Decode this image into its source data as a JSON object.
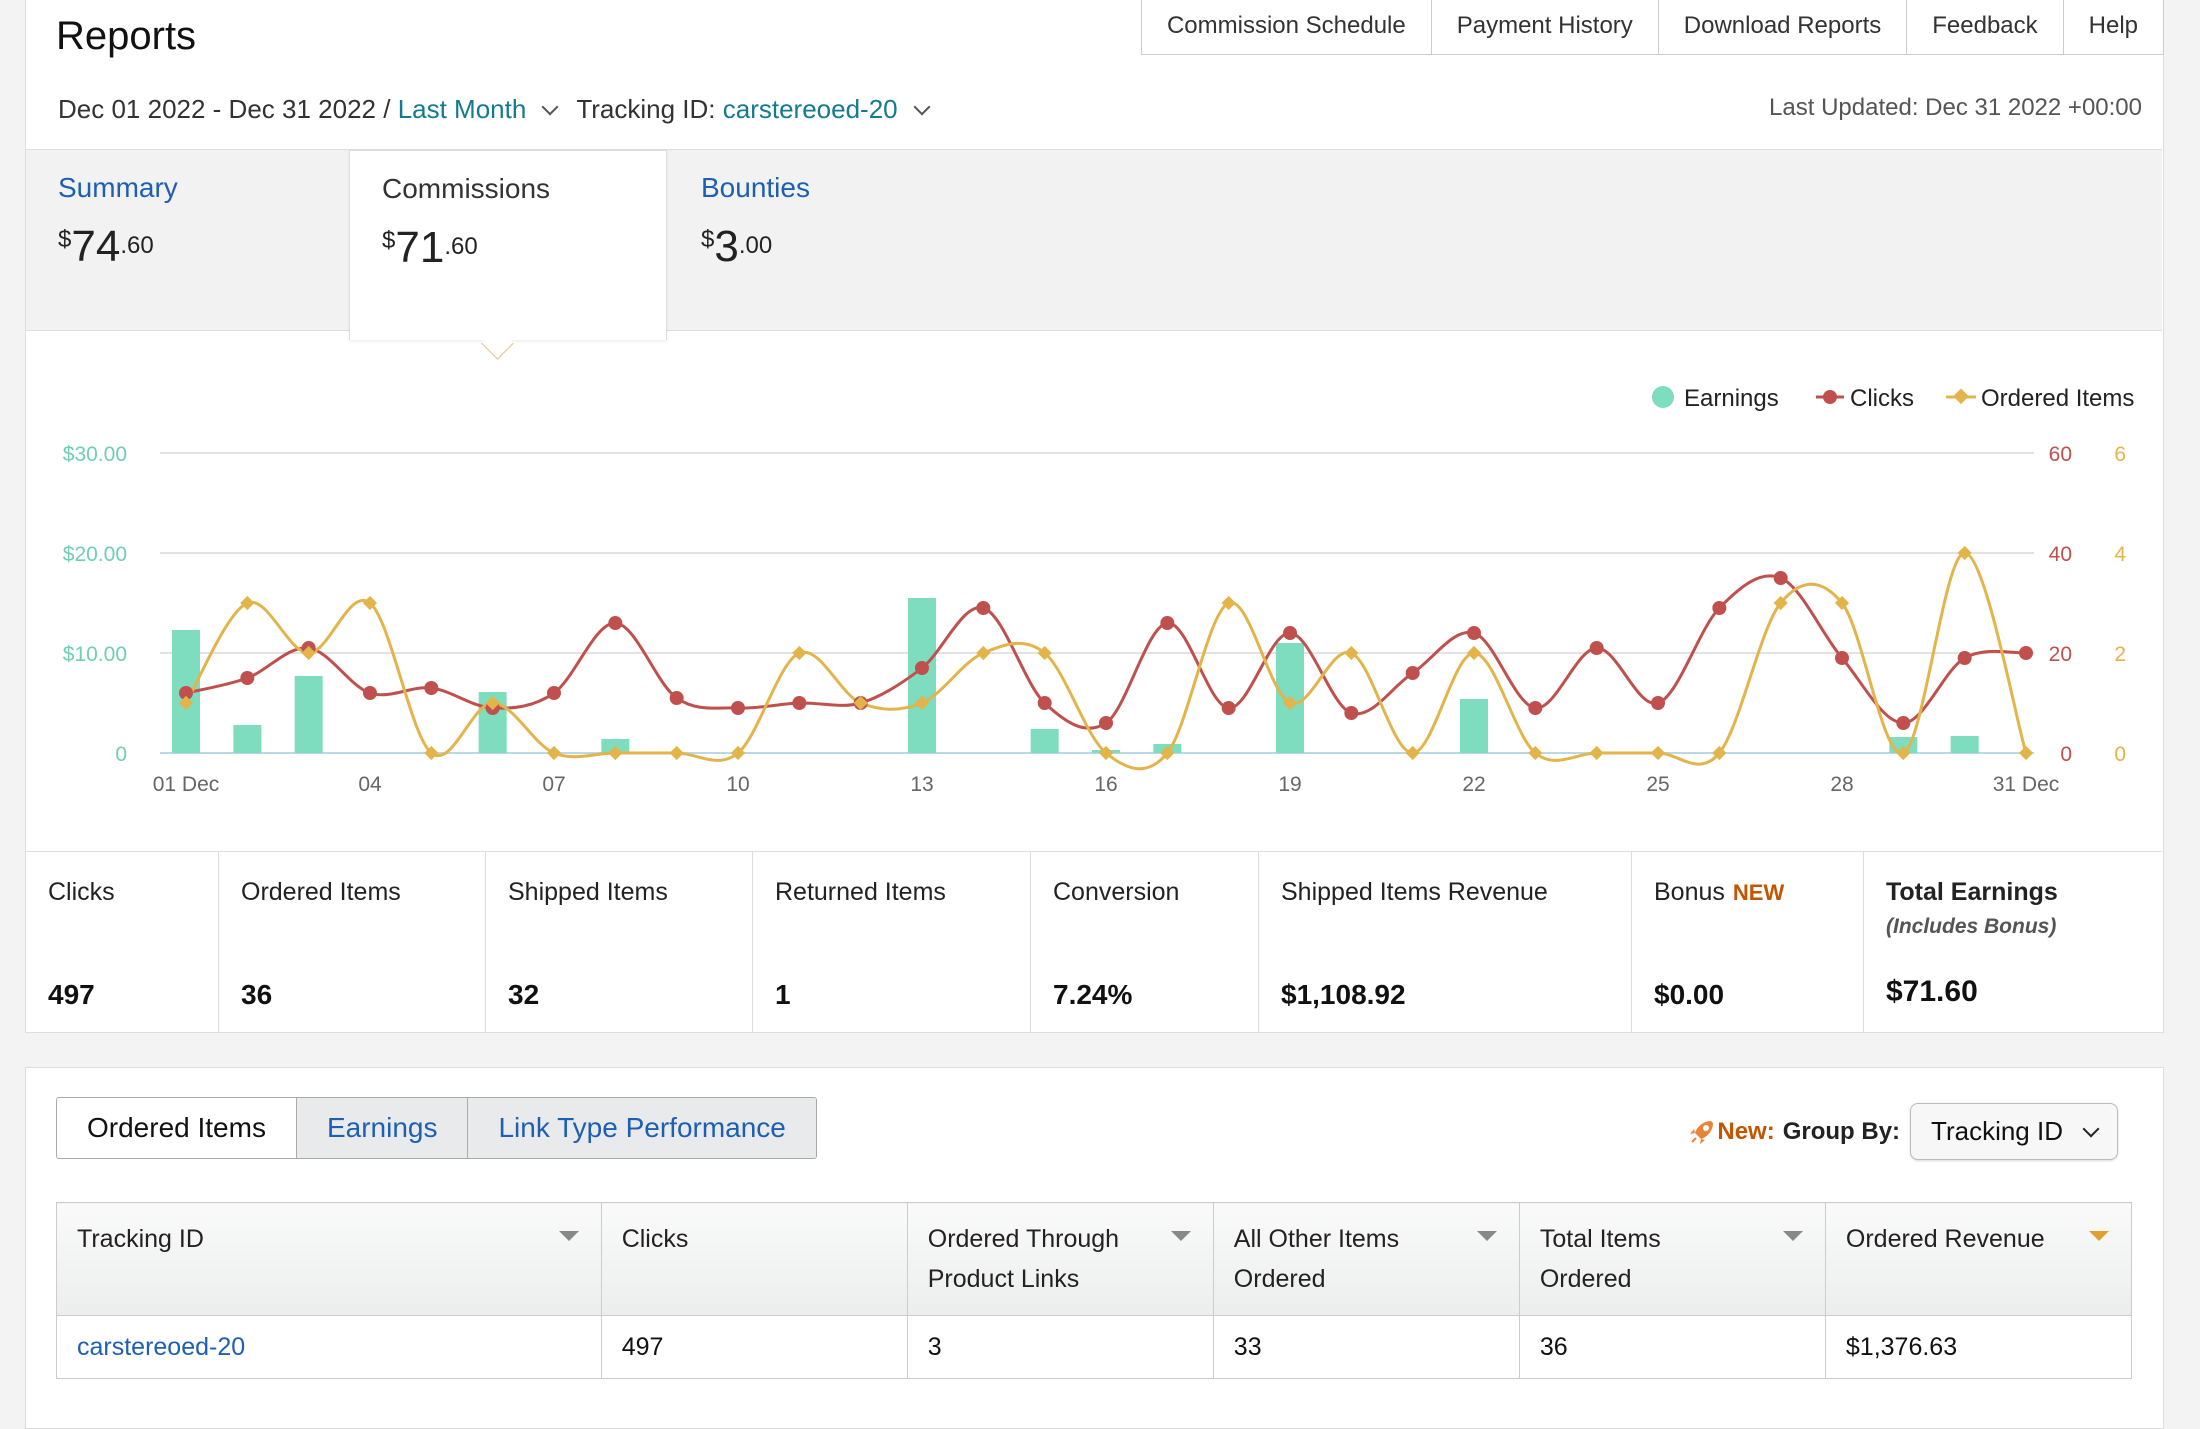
{
  "page": {
    "title": "Reports"
  },
  "nav_tabs": [
    "Commission Schedule",
    "Payment History",
    "Download Reports",
    "Feedback",
    "Help"
  ],
  "filters": {
    "date_range": "Dec 01 2022 - Dec 31 2022 /",
    "preset": "Last Month",
    "tracking_label": "Tracking ID:",
    "tracking_value": "carstereoed-20"
  },
  "last_updated": "Last Updated: Dec 31 2022 +00:00",
  "summary_tabs": [
    {
      "label": "Summary",
      "currency": "$",
      "dollars": "74",
      "cents": ".60"
    },
    {
      "label": "Commissions",
      "currency": "$",
      "dollars": "71",
      "cents": ".60"
    },
    {
      "label": "Bounties",
      "currency": "$",
      "dollars": "3",
      "cents": ".00"
    }
  ],
  "chart_data": {
    "type": "bar",
    "legend": [
      "Earnings",
      "Clicks",
      "Ordered Items"
    ],
    "legend_position": "top-right",
    "categories": [
      "01 Dec",
      "02",
      "03",
      "04",
      "05",
      "06",
      "07",
      "08",
      "09",
      "10",
      "11",
      "12",
      "13",
      "14",
      "15",
      "16",
      "17",
      "18",
      "19",
      "20",
      "21",
      "22",
      "23",
      "24",
      "25",
      "26",
      "27",
      "28",
      "29",
      "30",
      "31 Dec"
    ],
    "x_tick_labels": [
      "01 Dec",
      "04",
      "07",
      "10",
      "13",
      "16",
      "19",
      "22",
      "25",
      "28",
      "31 Dec"
    ],
    "y_left": {
      "ticks": [
        "0",
        "$10.00",
        "$20.00",
        "$30.00"
      ],
      "range": [
        0,
        30
      ]
    },
    "y_right_clicks": {
      "ticks": [
        "0",
        "20",
        "40",
        "60"
      ],
      "range": [
        0,
        60
      ]
    },
    "y_right_items": {
      "ticks": [
        "0",
        "2",
        "4",
        "6"
      ],
      "range": [
        0,
        6
      ]
    },
    "series": [
      {
        "name": "Earnings",
        "type": "bar",
        "color": "#7edcbf",
        "values": [
          12.3,
          2.8,
          7.7,
          0,
          0,
          6.1,
          0,
          1.4,
          0,
          0,
          0,
          0,
          15.5,
          0,
          2.4,
          0.3,
          0.9,
          0,
          11.0,
          0,
          0,
          5.4,
          0,
          0,
          0,
          0,
          0,
          0,
          1.6,
          1.7,
          0
        ]
      },
      {
        "name": "Clicks",
        "type": "line",
        "color": "#c0504d",
        "values": [
          12,
          15,
          21,
          12,
          13,
          9,
          12,
          26,
          11,
          9,
          10,
          10,
          17,
          29,
          10,
          6,
          26,
          9,
          24,
          8,
          16,
          24,
          9,
          21,
          10,
          29,
          35,
          19,
          6,
          19,
          20
        ]
      },
      {
        "name": "Ordered Items",
        "type": "line",
        "color": "#e3b44a",
        "values": [
          1,
          3,
          2,
          3,
          0,
          1,
          0,
          0,
          0,
          0,
          2,
          1,
          1,
          2,
          2,
          0,
          0,
          3,
          1,
          2,
          0,
          2,
          0,
          0,
          0,
          0,
          3,
          3,
          0,
          4,
          0
        ]
      }
    ],
    "grid": true
  },
  "stats": [
    {
      "label": "Clicks",
      "value": "497"
    },
    {
      "label": "Ordered Items",
      "value": "36"
    },
    {
      "label": "Shipped Items",
      "value": "32"
    },
    {
      "label": "Returned Items",
      "value": "1"
    },
    {
      "label": "Conversion",
      "value": "7.24%"
    },
    {
      "label": "Shipped Items Revenue",
      "value": "$1,108.92"
    },
    {
      "label": "Bonus",
      "badge": "NEW",
      "value": "$0.00"
    },
    {
      "label": "Total Earnings",
      "sub": "(Includes Bonus)",
      "value": "$71.60"
    }
  ],
  "report_tabs": [
    "Ordered Items",
    "Earnings",
    "Link Type Performance"
  ],
  "group_by": {
    "new_label": "New:",
    "label": "Group By:",
    "value": "Tracking ID"
  },
  "table": {
    "headers": [
      [
        "Tracking ID"
      ],
      [
        "Clicks"
      ],
      [
        "Ordered Through",
        "Product Links"
      ],
      [
        "All Other Items",
        "Ordered"
      ],
      [
        "Total Items",
        "Ordered"
      ],
      [
        "Ordered Revenue"
      ]
    ],
    "rows": [
      [
        "carstereoed-20",
        "497",
        "3",
        "33",
        "36",
        "$1,376.63"
      ]
    ]
  }
}
